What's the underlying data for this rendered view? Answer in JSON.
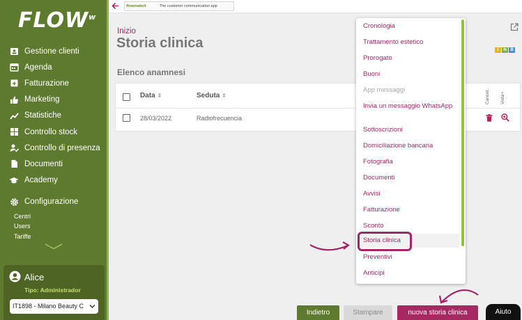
{
  "app": {
    "logo": "FLOW",
    "logo_sup": "w"
  },
  "topbar": {
    "banner_brand": "flowmakeit",
    "banner_text": "The customer communication app"
  },
  "sidebar": {
    "items": [
      {
        "label": "Gestione clienti",
        "icon": "person-card-icon"
      },
      {
        "label": "Agenda",
        "icon": "calendar-icon"
      },
      {
        "label": "Fatturazione",
        "icon": "invoice-icon"
      },
      {
        "label": "Marketing",
        "icon": "thumbs-up-icon"
      },
      {
        "label": "Statistiche",
        "icon": "chart-icon"
      },
      {
        "label": "Controllo stock",
        "icon": "boxes-icon"
      },
      {
        "label": "Controllo di presenza",
        "icon": "user-check-icon"
      },
      {
        "label": "Documenti",
        "icon": "document-icon"
      },
      {
        "label": "Academy",
        "icon": "graduation-cap-icon"
      }
    ],
    "config": {
      "label": "Configurazione",
      "sub": [
        "Centri",
        "Users",
        "Tariffe"
      ]
    }
  },
  "user": {
    "name": "Alice",
    "role": "Tipo: Administrador",
    "center": "IT1898 - Milano Beauty C"
  },
  "page": {
    "breadcrumb": "Inizio",
    "title": "Storia clinica",
    "section": "Elenco anamnesi",
    "badges": [
      {
        "label": "I",
        "color": "#e6b422"
      },
      {
        "label": "N",
        "color": "#7bb34a"
      },
      {
        "label": "B",
        "color": "#4a90c8"
      }
    ]
  },
  "table": {
    "headers": {
      "date": "Data",
      "session": "Seduta",
      "delete": "Cancel..",
      "view": "Vista+"
    },
    "rows": [
      {
        "date": "28/03/2022",
        "session": "Radiofrecuencia"
      }
    ]
  },
  "menu": {
    "items": [
      {
        "label": "Cronologia"
      },
      {
        "label": "Trattamento estetico"
      },
      {
        "label": "Prorogato"
      },
      {
        "label": "Buoni"
      },
      {
        "label": "App messaggi",
        "disabled": true
      },
      {
        "label": "Invia un messaggio WhatsApp"
      },
      {
        "label": "Sottoscrizioni"
      },
      {
        "label": "Domiciliazione bancaria"
      },
      {
        "label": "Fotografia"
      },
      {
        "label": "Documenti"
      },
      {
        "label": "Avvisi"
      },
      {
        "label": "Fatturazione"
      },
      {
        "label": "Sconto"
      },
      {
        "label": "Storia clinica",
        "selected": true
      },
      {
        "label": "Preventivi"
      },
      {
        "label": "Anticipi"
      }
    ]
  },
  "buttons": {
    "back": "Indietro",
    "print": "Stampare",
    "new": "nuova storia clinica",
    "help": "Aiuto"
  },
  "colors": {
    "sidebar": "#5e7a2e",
    "accent": "#9b2a6a",
    "primary_button": "#a52a62"
  }
}
